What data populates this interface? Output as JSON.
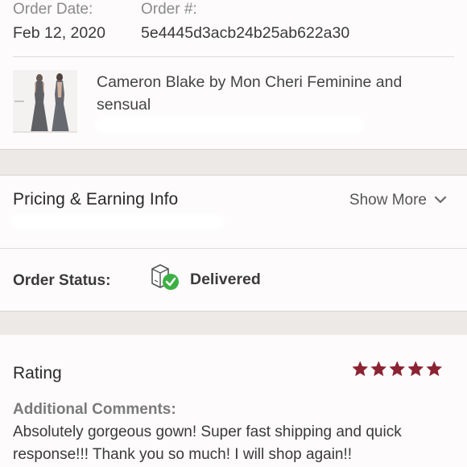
{
  "order": {
    "date_label": "Order Date:",
    "date_value": "Feb 12, 2020",
    "number_label": "Order #:",
    "number_value": "5e4445d3acb24b25ab622a30"
  },
  "product": {
    "title": "Cameron Blake by Mon Cheri Feminine and sensual",
    "thumbnail_icon": "dress-photo-thumbnail"
  },
  "pricing": {
    "title": "Pricing & Earning Info",
    "show_more_label": "Show More",
    "toggle_icon": "chevron-down-icon"
  },
  "status": {
    "label": "Order Status:",
    "value": "Delivered",
    "icon": "package-delivered-icon",
    "check_color": "#3cb043"
  },
  "rating": {
    "title": "Rating",
    "stars": 5,
    "max_stars": 5,
    "star_color": "#8b2333",
    "comments_label": "Additional Comments:",
    "comments_text": "Absolutely gorgeous gown! Super fast shipping and quick response!!! Thank you so much! I will shop again!!"
  },
  "colors": {
    "section_band": "#ece9e6",
    "accent_star": "#8b2333"
  }
}
